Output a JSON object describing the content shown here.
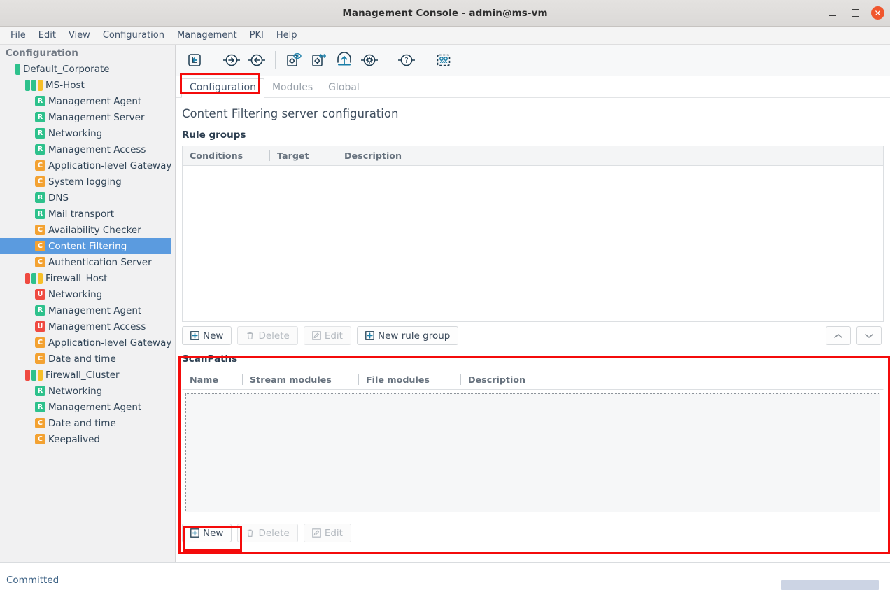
{
  "window": {
    "title": "Management Console - admin@ms-vm",
    "controls": {
      "minimize": "minimize",
      "maximize": "maximize",
      "close": "✕"
    }
  },
  "menubar": {
    "items": [
      {
        "label": "File"
      },
      {
        "label": "Edit"
      },
      {
        "label": "View"
      },
      {
        "label": "Configuration"
      },
      {
        "label": "Management"
      },
      {
        "label": "PKI"
      },
      {
        "label": "Help"
      }
    ]
  },
  "toolbar": {
    "buttons": [
      {
        "name": "go-up-icon"
      },
      {
        "name": "import-arrow-right-icon"
      },
      {
        "name": "export-arrow-left-icon"
      },
      {
        "name": "preview-config-icon"
      },
      {
        "name": "compare-config-icon"
      },
      {
        "name": "upload-config-icon"
      },
      {
        "name": "settings-gear-icon"
      },
      {
        "name": "help-question-icon"
      },
      {
        "name": "robot-assistant-icon"
      }
    ]
  },
  "sidebar": {
    "root_label": "Configuration",
    "nodes": [
      {
        "label": "Default_Corporate",
        "indent": 1,
        "kind": "bars",
        "bars": [
          "#2ec18c"
        ],
        "selected": false
      },
      {
        "label": "MS-Host",
        "indent": 2,
        "kind": "bars",
        "bars": [
          "#2ec18c",
          "#2ec18c",
          "#f7bf29"
        ],
        "selected": false
      },
      {
        "label": "Management Agent",
        "indent": 3,
        "kind": "badge",
        "badge": "R",
        "badge_color": "#2ec18c",
        "selected": false
      },
      {
        "label": "Management Server",
        "indent": 3,
        "kind": "badge",
        "badge": "R",
        "badge_color": "#2ec18c",
        "selected": false
      },
      {
        "label": "Networking",
        "indent": 3,
        "kind": "badge",
        "badge": "R",
        "badge_color": "#2ec18c",
        "selected": false
      },
      {
        "label": "Management Access",
        "indent": 3,
        "kind": "badge",
        "badge": "R",
        "badge_color": "#2ec18c",
        "selected": false
      },
      {
        "label": "Application-level Gateway",
        "indent": 3,
        "kind": "badge",
        "badge": "C",
        "badge_color": "#f3a232",
        "selected": false
      },
      {
        "label": "System logging",
        "indent": 3,
        "kind": "badge",
        "badge": "C",
        "badge_color": "#f3a232",
        "selected": false
      },
      {
        "label": "DNS",
        "indent": 3,
        "kind": "badge",
        "badge": "R",
        "badge_color": "#2ec18c",
        "selected": false
      },
      {
        "label": "Mail transport",
        "indent": 3,
        "kind": "badge",
        "badge": "R",
        "badge_color": "#2ec18c",
        "selected": false
      },
      {
        "label": "Availability Checker",
        "indent": 3,
        "kind": "badge",
        "badge": "C",
        "badge_color": "#f3a232",
        "selected": false
      },
      {
        "label": "Content Filtering",
        "indent": 3,
        "kind": "badge",
        "badge": "C",
        "badge_color": "#f3a232",
        "selected": true
      },
      {
        "label": "Authentication Server",
        "indent": 3,
        "kind": "badge",
        "badge": "C",
        "badge_color": "#f3a232",
        "selected": false
      },
      {
        "label": "Firewall_Host",
        "indent": 2,
        "kind": "bars",
        "bars": [
          "#ef4a41",
          "#2ec18c",
          "#f7bf29"
        ],
        "selected": false
      },
      {
        "label": "Networking",
        "indent": 3,
        "kind": "badge",
        "badge": "U",
        "badge_color": "#ef4a41",
        "selected": false
      },
      {
        "label": "Management Agent",
        "indent": 3,
        "kind": "badge",
        "badge": "R",
        "badge_color": "#2ec18c",
        "selected": false
      },
      {
        "label": "Management Access",
        "indent": 3,
        "kind": "badge",
        "badge": "U",
        "badge_color": "#ef4a41",
        "selected": false
      },
      {
        "label": "Application-level Gateway",
        "indent": 3,
        "kind": "badge",
        "badge": "C",
        "badge_color": "#f3a232",
        "selected": false
      },
      {
        "label": "Date and time",
        "indent": 3,
        "kind": "badge",
        "badge": "C",
        "badge_color": "#f3a232",
        "selected": false
      },
      {
        "label": "Firewall_Cluster",
        "indent": 2,
        "kind": "bars",
        "bars": [
          "#ef4a41",
          "#2ec18c",
          "#f7bf29"
        ],
        "selected": false
      },
      {
        "label": "Networking",
        "indent": 3,
        "kind": "badge",
        "badge": "R",
        "badge_color": "#2ec18c",
        "selected": false
      },
      {
        "label": "Management Agent",
        "indent": 3,
        "kind": "badge",
        "badge": "R",
        "badge_color": "#2ec18c",
        "selected": false
      },
      {
        "label": "Date and time",
        "indent": 3,
        "kind": "badge",
        "badge": "C",
        "badge_color": "#f3a232",
        "selected": false
      },
      {
        "label": "Keepalived",
        "indent": 3,
        "kind": "badge",
        "badge": "C",
        "badge_color": "#f3a232",
        "selected": false
      }
    ]
  },
  "main": {
    "tabs": [
      {
        "label": "Configuration",
        "active": true
      },
      {
        "label": "Modules",
        "active": false
      },
      {
        "label": "Global",
        "active": false
      }
    ],
    "page_title": "Content Filtering server configuration",
    "rule_groups": {
      "label": "Rule groups",
      "columns": [
        "Conditions",
        "Target",
        "Description"
      ],
      "rows": [],
      "buttons": [
        {
          "label": "New",
          "icon": "plus-box-icon",
          "disabled": false
        },
        {
          "label": "Delete",
          "icon": "trash-icon",
          "disabled": true
        },
        {
          "label": "Edit",
          "icon": "pencil-icon",
          "disabled": true
        },
        {
          "label": "New rule group",
          "icon": "plus-box-icon",
          "disabled": false
        }
      ],
      "move_up": "chevron-up-icon",
      "move_down": "chevron-down-icon"
    },
    "scan_paths": {
      "label": "ScanPaths",
      "columns": [
        "Name",
        "Stream modules",
        "File modules",
        "Description"
      ],
      "rows": [],
      "buttons": [
        {
          "label": "New",
          "icon": "plus-box-icon",
          "disabled": false
        },
        {
          "label": "Delete",
          "icon": "trash-icon",
          "disabled": true
        },
        {
          "label": "Edit",
          "icon": "pencil-icon",
          "disabled": true
        }
      ]
    }
  },
  "statusbar": {
    "text": "Committed"
  },
  "colors": {
    "highlight": "#f40b0b",
    "selection": "#5b9bdf",
    "accent": "#1a7ea8",
    "status_green": "#2ec18c",
    "status_yellow": "#f3a232",
    "status_red": "#ef4a41"
  }
}
